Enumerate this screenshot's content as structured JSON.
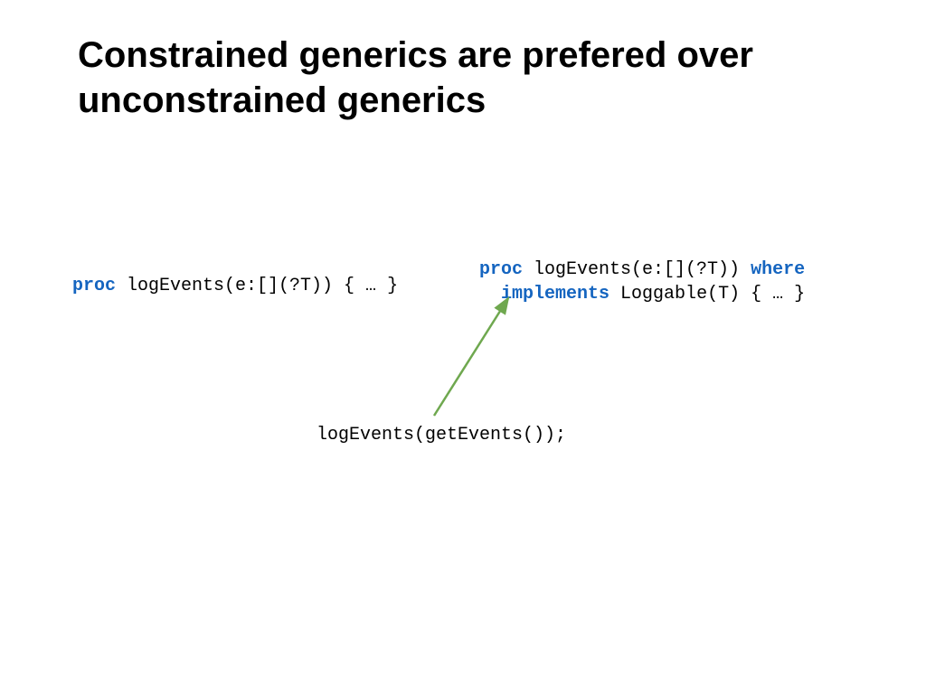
{
  "title": "Constrained generics are prefered over unconstrained generics",
  "left": {
    "kw_proc": "proc",
    "rest": " logEvents(e:[](?T)) { … }"
  },
  "right": {
    "kw_proc": "proc",
    "part1": " logEvents(e:[](?T)) ",
    "kw_where": "where",
    "indent": "  ",
    "kw_implements": "implements",
    "part2": " Loggable(T) { … }"
  },
  "bottom": "logEvents(getEvents());",
  "colors": {
    "keyword": "#1565c0",
    "arrow": "#6fa84f"
  }
}
